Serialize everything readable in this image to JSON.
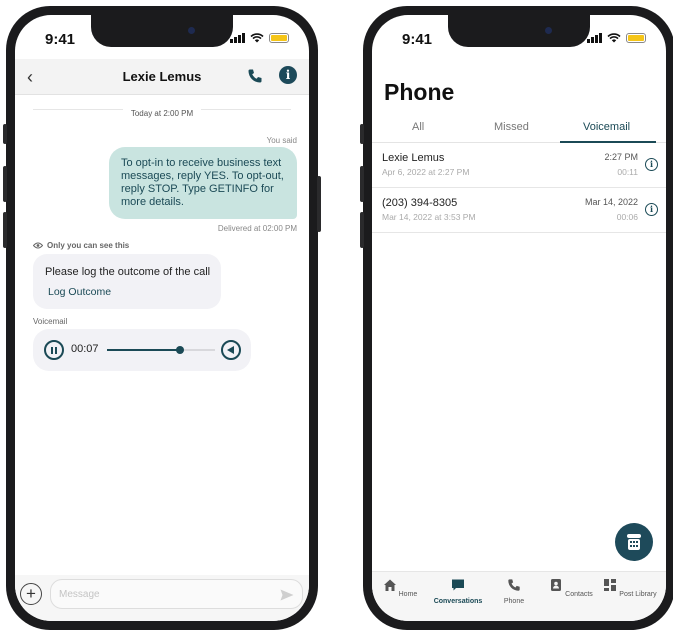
{
  "status_bar": {
    "time": "9:41"
  },
  "left": {
    "header": {
      "title": "Lexie Lemus"
    },
    "date_divider": "Today at 2:00 PM",
    "you_said": "You said",
    "outgoing_message": "To opt-in to receive business text messages, reply YES. To opt-out, reply STOP. Type GETINFO for more details.",
    "delivered": "Delivered at 02:00 PM",
    "only_you": "Only you can see this",
    "note": {
      "text": "Please log the outcome of the call",
      "link": "Log Outcome"
    },
    "voicemail": {
      "label": "Voicemail",
      "time": "00:07",
      "progress_percent": 68
    },
    "composer": {
      "placeholder": "Message"
    }
  },
  "right": {
    "title": "Phone",
    "tabs": [
      {
        "label": "All"
      },
      {
        "label": "Missed"
      },
      {
        "label": "Voicemail",
        "active": true
      }
    ],
    "voicemails": [
      {
        "name": "Lexie Lemus",
        "date": "Apr 6, 2022 at 2:27 PM",
        "time": "2:27 PM",
        "duration": "00:11"
      },
      {
        "name": "(203) 394-8305",
        "date": "Mar 14, 2022 at 3:53 PM",
        "time": "Mar 14, 2022",
        "duration": "00:06"
      }
    ],
    "tabbar": [
      {
        "label": "Home",
        "icon": "home-icon"
      },
      {
        "label": "Conversations",
        "icon": "chat-icon",
        "active": true
      },
      {
        "label": "Phone",
        "icon": "phone-icon"
      },
      {
        "label": "Contacts",
        "icon": "contacts-icon"
      },
      {
        "label": "Post Library",
        "icon": "grid-icon"
      }
    ]
  },
  "colors": {
    "accent": "#1b4a56",
    "outgoing_bubble": "#c9e4e0",
    "battery": "#f5c518"
  }
}
